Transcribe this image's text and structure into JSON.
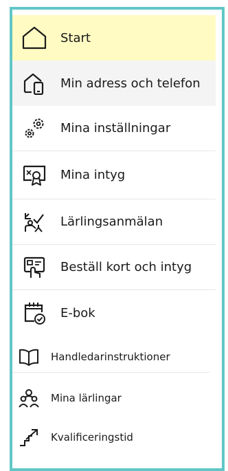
{
  "menu": {
    "items": [
      {
        "label": "Start",
        "icon": "home-icon"
      },
      {
        "label": "Min adress och telefon",
        "icon": "home-phone-icon"
      },
      {
        "label": "Mina inställningar",
        "icon": "gears-icon"
      },
      {
        "label": "Mina intyg",
        "icon": "certificate-icon"
      },
      {
        "label": "Lärlingsanmälan",
        "icon": "apprentice-registration-icon"
      },
      {
        "label": "Beställ kort och intyg",
        "icon": "order-card-icon"
      },
      {
        "label": "E-bok",
        "icon": "calendar-check-icon"
      },
      {
        "label": "Handledarinstruktioner",
        "icon": "book-icon"
      },
      {
        "label": "Mina lärlingar",
        "icon": "people-icon"
      },
      {
        "label": "Kvalificeringstid",
        "icon": "stairs-arrow-icon"
      }
    ]
  },
  "colors": {
    "frame_border": "#62c6c6",
    "active_background": "#fffbc2",
    "hover_background": "#f4f4f4"
  }
}
